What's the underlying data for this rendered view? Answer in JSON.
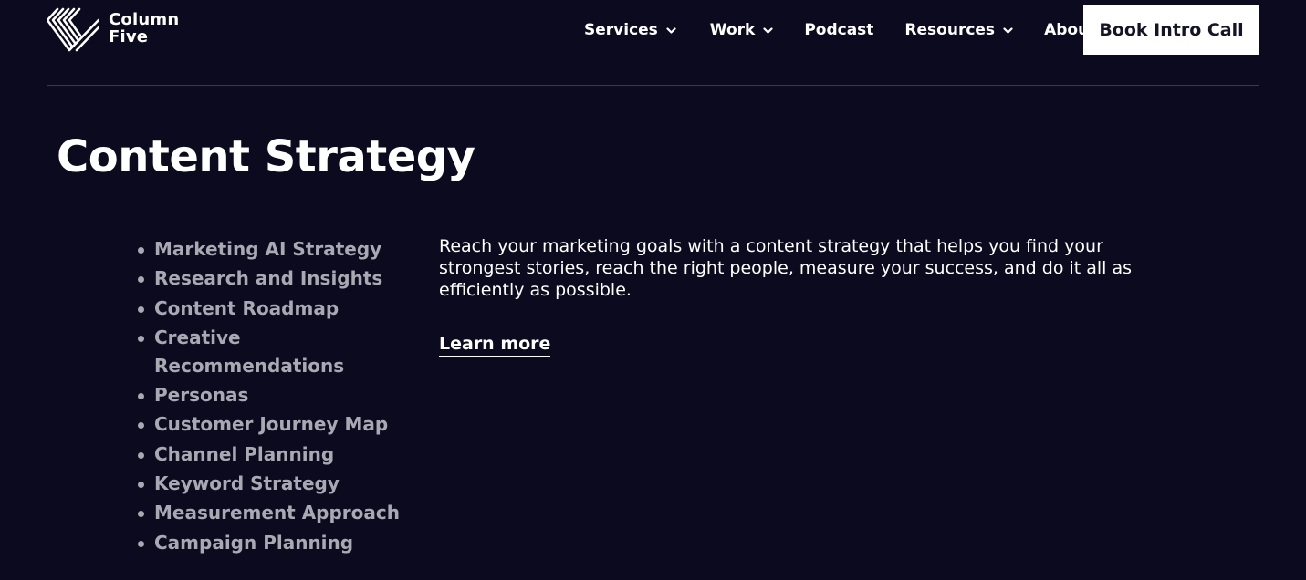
{
  "brand": {
    "name_line1": "Column",
    "name_line2": "Five",
    "logo_icon": "column-five-stripes-logo"
  },
  "nav": {
    "items": [
      {
        "label": "Services",
        "has_dropdown": true
      },
      {
        "label": "Work",
        "has_dropdown": true
      },
      {
        "label": "Podcast",
        "has_dropdown": false
      },
      {
        "label": "Resources",
        "has_dropdown": true
      },
      {
        "label": "About",
        "has_dropdown": false
      }
    ],
    "cta_label": "Book Intro Call"
  },
  "main": {
    "title": "Content Strategy",
    "services": [
      "Marketing AI Strategy",
      "Research and Insights",
      "Content Roadmap",
      "Creative Recommendations",
      "Personas",
      "Customer Journey Map",
      "Channel Planning",
      "Keyword Strategy",
      "Measurement Approach",
      "Campaign Planning"
    ],
    "description": "Reach your marketing goals with a content strategy that helps you find your strongest stories, reach the right people, measure your success, and do it all as efficiently as possible.",
    "learn_more_label": "Learn more"
  },
  "colors": {
    "background": "#0b0a1e",
    "text": "#ffffff",
    "muted_text": "#a9a9b3",
    "divider": "#3b3a52",
    "cta_background": "#ffffff",
    "cta_text": "#141428"
  }
}
